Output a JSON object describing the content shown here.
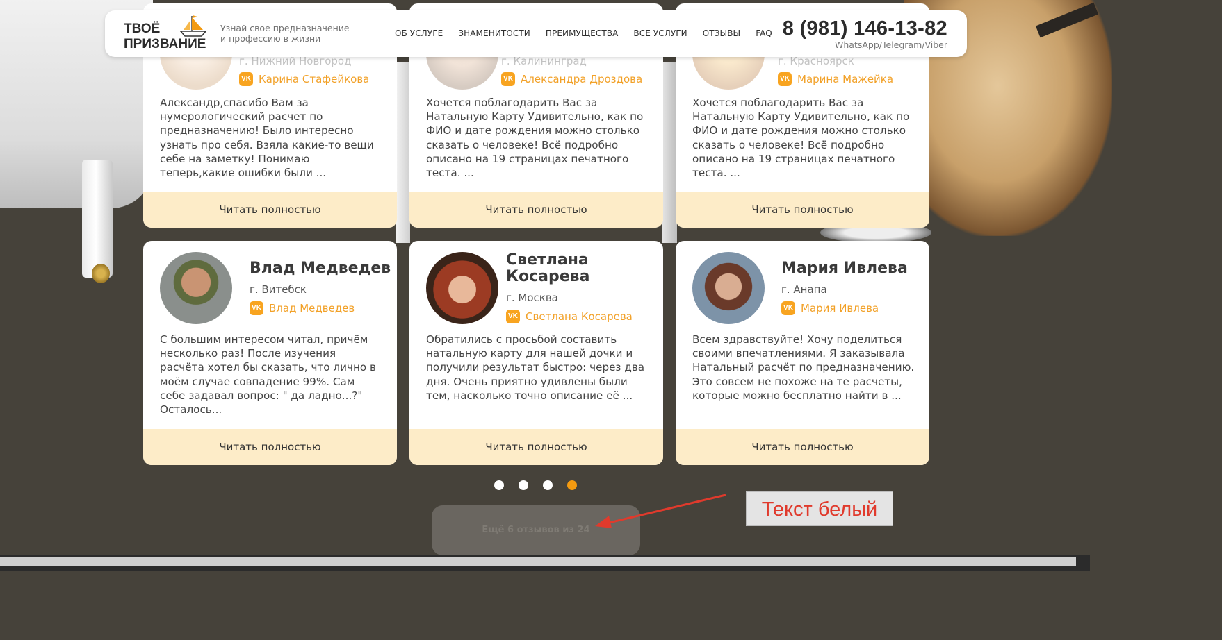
{
  "header": {
    "logo_line1": "ТВОЁ",
    "logo_line2": "ПРИЗВАНИЕ",
    "tagline_line1": "Узнай свое предназначение",
    "tagline_line2": "и профессию в жизни",
    "nav": [
      "ОБ УСЛУГЕ",
      "ЗНАМЕНИТОСТИ",
      "ПРЕИМУЩЕСТВА",
      "ВСЕ УСЛУГИ",
      "ОТЗЫВЫ",
      "FAQ"
    ],
    "phone": "8 (981) 146-13-82",
    "phone_sub": "WhatsApp/Telegram/Viber",
    "accent_color": "#f39a10"
  },
  "reviews_top": [
    {
      "city": "г. Нижний Новгород",
      "vk_name": "Карина Стафейкова",
      "text": "Александр,спасибо Вам за нумерологический расчет по предназначению! Было интересно узнать про себя. Взяла какие-то вещи себе на заметку! Понимаю теперь,какие ошибки были ...",
      "read_more": "Читать полностью"
    },
    {
      "city": "г. Калининград",
      "vk_name": "Александра Дроздова",
      "text": "Хочется поблагодарить Вас за Натальную Карту Удивительно, как по ФИО и дате рождения можно столько сказать о человеке! Всё подробно описано на 19 страницах печатного теста. ...",
      "read_more": "Читать полностью"
    },
    {
      "city": "г. Красноярск",
      "vk_name": "Марина Мажейка",
      "text": "Хочется поблагодарить Вас за Натальную Карту Удивительно, как по ФИО и дате рождения можно столько сказать о человеке! Всё подробно описано на 19 страницах печатного теста. ...",
      "read_more": "Читать полностью"
    }
  ],
  "reviews_bottom": [
    {
      "name": "Влад Медведев",
      "city": "г. Витебск",
      "vk_name": "Влад Медведев",
      "text": "С большим интересом читал, причём несколько раз! После изучения расчёта хотел бы сказать, что лично в моём случае совпадение 99%. Сам себе задавал вопрос: \" да ладно...?\" Осталось...",
      "read_more": "Читать полностью"
    },
    {
      "name_line1": "Светлана",
      "name_line2": "Косарева",
      "city": "г. Москва",
      "vk_name": "Светлана Косарева",
      "text": "Обратились с просьбой составить натальную карту для нашей дочки и получили результат быстро: через два дня. Очень приятно удивлены были тем, насколько точно описание её ...",
      "read_more": "Читать полностью"
    },
    {
      "name": "Мария Ивлева",
      "city": "г. Анапа",
      "vk_name": "Мария Ивлева",
      "text": "Всем здравствуйте! Хочу поделиться своими впечатлениями. Я заказывала Натальный расчёт по предназначению. Это совсем не похоже на те расчеты, которые можно бесплатно найти в ...",
      "read_more": "Читать полностью"
    }
  ],
  "vk_icon_label": "VK",
  "pagination": {
    "count": 4,
    "active_index": 3
  },
  "more_button": "Ещё 6 отзывов из 24",
  "annotation": "Текст белый",
  "annotation_color": "#e03a2c"
}
